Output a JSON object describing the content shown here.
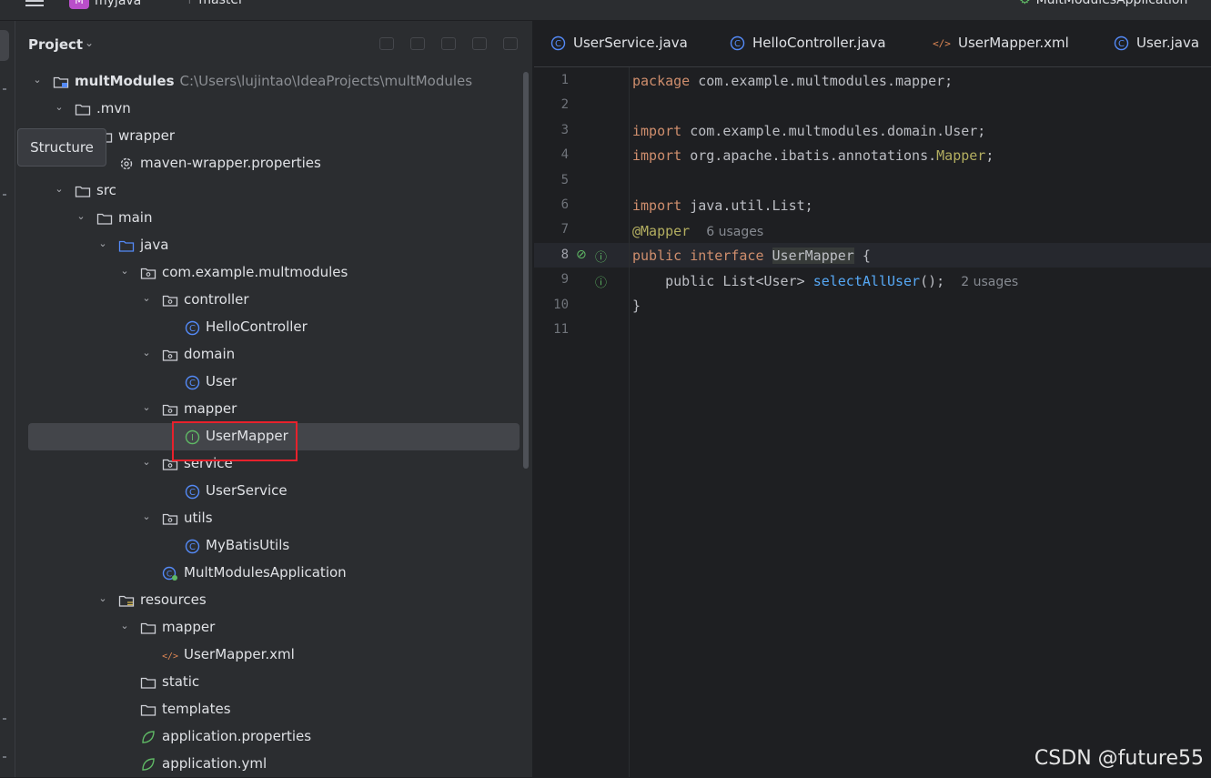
{
  "topbar": {
    "project_badge": "M",
    "project": "myjava",
    "branch": "master",
    "run_config": "MultModulesApplication"
  },
  "panel": {
    "title": "Project"
  },
  "tooltip": {
    "text": "Structure"
  },
  "tree": [
    {
      "label": "multModules",
      "path": "C:\\Users\\lujintao\\IdeaProjects\\multModules",
      "depth": 0,
      "icon": "module-folder-icon",
      "expanded": true,
      "bold": true
    },
    {
      "label": ".mvn",
      "depth": 1,
      "icon": "folder-icon",
      "expanded": true
    },
    {
      "label": "wrapper",
      "depth": 2,
      "icon": "folder-icon",
      "expanded": true
    },
    {
      "label": "maven-wrapper.properties",
      "depth": 3,
      "icon": "gear-icon"
    },
    {
      "label": "src",
      "depth": 1,
      "icon": "folder-icon",
      "expanded": true
    },
    {
      "label": "main",
      "depth": 2,
      "icon": "folder-icon",
      "expanded": true
    },
    {
      "label": "java",
      "depth": 3,
      "icon": "source-folder-icon",
      "expanded": true
    },
    {
      "label": "com.example.multmodules",
      "depth": 4,
      "icon": "package-icon",
      "expanded": true
    },
    {
      "label": "controller",
      "depth": 5,
      "icon": "package-icon",
      "expanded": true
    },
    {
      "label": "HelloController",
      "depth": 6,
      "icon": "class-icon"
    },
    {
      "label": "domain",
      "depth": 5,
      "icon": "package-icon",
      "expanded": true
    },
    {
      "label": "User",
      "depth": 6,
      "icon": "class-icon"
    },
    {
      "label": "mapper",
      "depth": 5,
      "icon": "package-icon",
      "expanded": true
    },
    {
      "label": "UserMapper",
      "depth": 6,
      "icon": "interface-icon",
      "selected": true
    },
    {
      "label": "service",
      "depth": 5,
      "icon": "package-icon",
      "expanded": true
    },
    {
      "label": "UserService",
      "depth": 6,
      "icon": "class-icon"
    },
    {
      "label": "utils",
      "depth": 5,
      "icon": "package-icon",
      "expanded": true
    },
    {
      "label": "MyBatisUtils",
      "depth": 6,
      "icon": "class-icon"
    },
    {
      "label": "MultModulesApplication",
      "depth": 5,
      "icon": "spring-boot-class-icon"
    },
    {
      "label": "resources",
      "depth": 3,
      "icon": "resources-folder-icon",
      "expanded": true
    },
    {
      "label": "mapper",
      "depth": 4,
      "icon": "folder-icon",
      "expanded": true
    },
    {
      "label": "UserMapper.xml",
      "depth": 5,
      "icon": "xml-icon"
    },
    {
      "label": "static",
      "depth": 4,
      "icon": "folder-icon"
    },
    {
      "label": "templates",
      "depth": 4,
      "icon": "folder-icon"
    },
    {
      "label": "application.properties",
      "depth": 4,
      "icon": "spring-config-icon"
    },
    {
      "label": "application.yml",
      "depth": 4,
      "icon": "spring-config-icon"
    }
  ],
  "tabs": [
    {
      "label": "UserService.java",
      "icon": "class-icon"
    },
    {
      "label": "HelloController.java",
      "icon": "class-icon"
    },
    {
      "label": "UserMapper.xml",
      "icon": "xml-icon"
    },
    {
      "label": "User.java",
      "icon": "class-icon"
    }
  ],
  "line_numbers": [
    "1",
    "2",
    "3",
    "4",
    "5",
    "6",
    "7",
    "8",
    "9",
    "10",
    "11"
  ],
  "active_line": "8",
  "code": {
    "l1_kw": "package",
    "l1_rest": " com.example.multmodules.mapper;",
    "l3_kw": "import",
    "l3_rest": " com.example.multmodules.domain.User;",
    "l4_kw": "import",
    "l4_mid": " org.apache.ibatis.annotations.",
    "l4_ann": "Mapper",
    "l4_end": ";",
    "l6_kw": "import",
    "l6_rest": " java.util.List;",
    "l7_ann": "@Mapper",
    "l7_hint": "6 usages",
    "l8_kw1": "public",
    "l8_kw2": "interface",
    "l8_name": "UserMapper",
    "l8_end": " {",
    "l9_pre": "public List<User> ",
    "l9_fn": "selectAllUser",
    "l9_end": "();",
    "l9_hint": "2 usages",
    "l10": "}"
  },
  "watermark": "CSDN @future55",
  "colors": {
    "accent_selection": "#43454a",
    "highlight_box": "#e8212c",
    "class_icon": "#548af7",
    "interface_icon": "#5fb865"
  }
}
